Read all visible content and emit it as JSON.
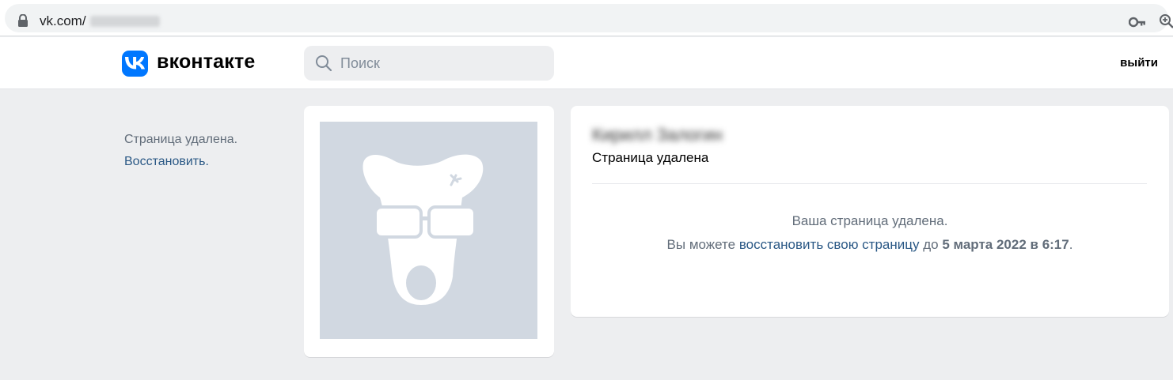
{
  "browser": {
    "url_prefix": "vk.com/",
    "lock_icon": "lock-icon",
    "key_icon": "key-icon",
    "zoom_icon": "zoom-icon"
  },
  "header": {
    "logo_text": "вконтакте",
    "brand_color": "#0077ff",
    "search_placeholder": "Поиск",
    "logout_label": "выйти"
  },
  "left_notice": {
    "deleted_text": "Страница удалена.",
    "restore_link": "Восстановить."
  },
  "profile": {
    "name": "Кирилл Залогин",
    "status": "Страница удалена",
    "message_line1": "Ваша страница удалена.",
    "message_line2_prefix": "Вы можете ",
    "message_link": "восстановить свою страницу",
    "message_mid": " до ",
    "message_date": "5 марта 2022 в 6:17",
    "message_suffix": "."
  },
  "colors": {
    "page_bg": "#edeef0",
    "link": "#2a5885",
    "secondary_text": "#626d7a",
    "avatar_bg": "#d1d8e1"
  }
}
